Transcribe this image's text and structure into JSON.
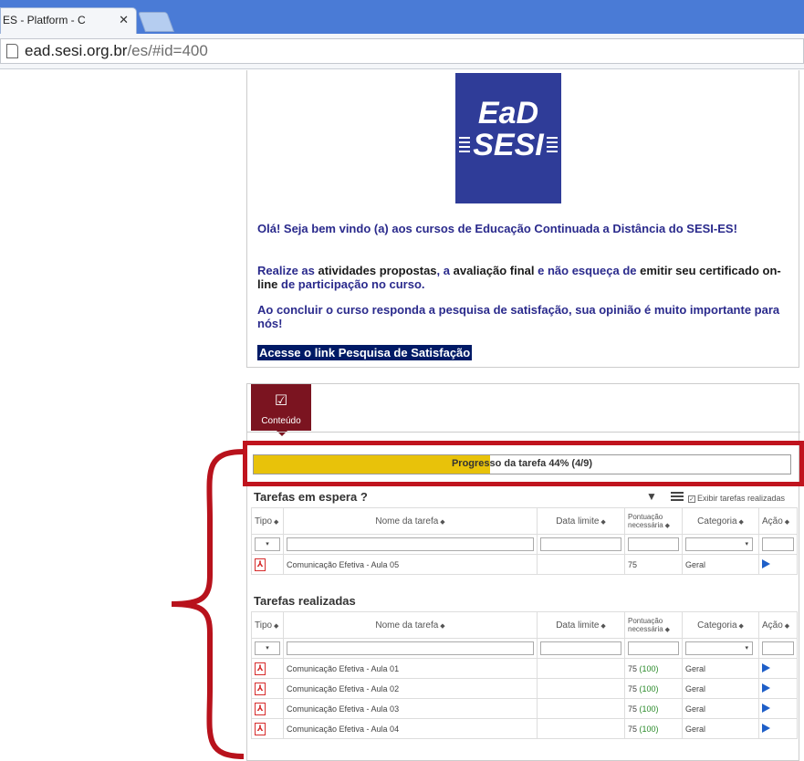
{
  "browser": {
    "tab_title": "ES - Platform - C",
    "url_domain": "ead.sesi.org.br",
    "url_path": "/es/#id=400"
  },
  "logo": {
    "line1": "EaD",
    "line2": "SESI"
  },
  "welcome": {
    "greeting": "Olá! Seja bem vindo (a) aos cursos de Educação Continuada a Distância do SESI-ES!",
    "instructions_part1": "Realize as ",
    "instructions_part2": "atividades propostas",
    "instructions_part3": ", a ",
    "instructions_part4": "avaliação final",
    "instructions_part5": " e não esqueça de ",
    "instructions_part6": "emitir seu certificado on-line",
    "instructions_part7": " de participação no curso.",
    "survey_text": "Ao concluir o curso responda a pesquisa de satisfação, sua opinião é muito importante para nós!",
    "survey_link": "Acesse o link Pesquisa de Satisfação"
  },
  "content_tab": {
    "label": "Conteúdo"
  },
  "progress": {
    "label": "Progresso da tarefa 44% (4/9)",
    "percent": 44
  },
  "pending": {
    "title": "Tarefas em espera ?",
    "show_done_label": "Exibir tarefas realizadas",
    "rows": [
      {
        "name": "Comunicação Efetiva - Aula 05",
        "deadline": "",
        "score": "75",
        "score_done": "",
        "category": "Geral"
      }
    ]
  },
  "done": {
    "title": "Tarefas realizadas",
    "rows": [
      {
        "name": "Comunicação Efetiva - Aula 01",
        "deadline": "",
        "score": "75",
        "score_done": "(100)",
        "category": "Geral"
      },
      {
        "name": "Comunicação Efetiva - Aula 02",
        "deadline": "",
        "score": "75",
        "score_done": "(100)",
        "category": "Geral"
      },
      {
        "name": "Comunicação Efetiva - Aula 03",
        "deadline": "",
        "score": "75",
        "score_done": "(100)",
        "category": "Geral"
      },
      {
        "name": "Comunicação Efetiva - Aula 04",
        "deadline": "",
        "score": "75",
        "score_done": "(100)",
        "category": "Geral"
      }
    ]
  },
  "columns": {
    "type": "Tipo",
    "name": "Nome da tarefa",
    "deadline": "Data limite",
    "score_line1": "Pontuação",
    "score_line2": "necessária",
    "category": "Categoria",
    "action": "Ação"
  },
  "filters": {
    "type_select": "▾",
    "category_select": "▾"
  },
  "colors": {
    "progress_fill": "#e8c20a",
    "tab_bg": "#7b1420",
    "logo_bg": "#2f3c98",
    "highlight": "#c0141e",
    "text_blue": "#2a2a8c"
  }
}
